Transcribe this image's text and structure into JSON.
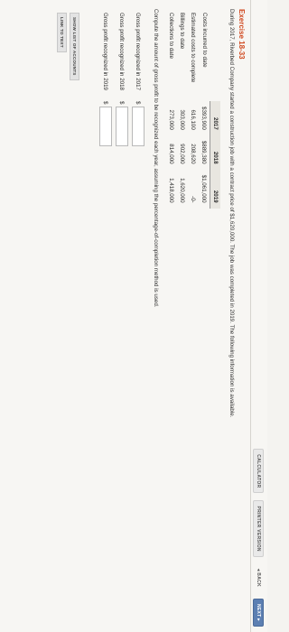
{
  "toolbar": {
    "calculator": "CALCULATOR",
    "printer_version": "PRINTER VERSION",
    "back": "◂ BACK",
    "next": "NEXT ▸"
  },
  "exercise": {
    "title": "Exercise 18-33",
    "intro": "During 2017, Riverbed Company started a construction job with a contract price of $1,620,000. The job was completed in 2019. The following information is available."
  },
  "table": {
    "headers": [
      "2017",
      "2018",
      "2019"
    ],
    "rows": [
      {
        "label": "Costs incurred to date",
        "values": [
          "$393,900",
          "$889,380",
          "$1,061,000"
        ]
      },
      {
        "label": "Estimated costs to complete",
        "values": [
          "616,100",
          "208,620",
          "-0-"
        ]
      },
      {
        "label": "Billings to date",
        "values": [
          "303,000",
          "902,000",
          "1,620,000"
        ]
      },
      {
        "label": "Collections to date",
        "values": [
          "273,000",
          "814,000",
          "1,418,000"
        ]
      }
    ]
  },
  "question": {
    "instruction": "Compute the amount of gross profit to be recognized each year, assuming the percentage-of-completion method is used.",
    "answers": [
      {
        "label": "Gross profit recognized in 2017",
        "currency": "$",
        "value": ""
      },
      {
        "label": "Gross profit recognized in 2018",
        "currency": "$",
        "value": ""
      },
      {
        "label": "Gross profit recognized in 2019",
        "currency": "$",
        "value": ""
      }
    ]
  },
  "buttons": {
    "show_accounts": "SHOW LIST OF ACCOUNTS",
    "link_to_text": "LINK TO TEXT"
  }
}
